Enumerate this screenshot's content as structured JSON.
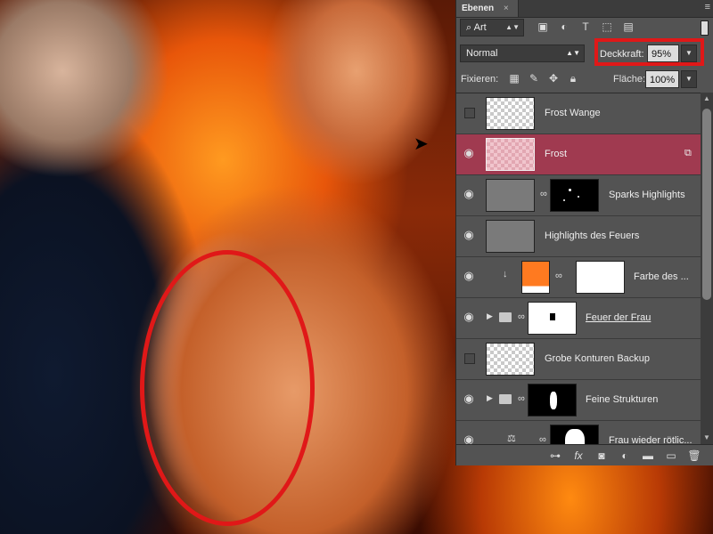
{
  "panel": {
    "tab_label": "Ebenen",
    "tab_close": "×",
    "menu_icon": "panel-menu-icon",
    "filter": {
      "selected": "Art",
      "icons": [
        "image-filter-icon",
        "adjustment-filter-icon",
        "type-filter-icon",
        "shape-filter-icon",
        "smart-object-filter-icon"
      ]
    },
    "blend_mode": "Normal",
    "opacity": {
      "label": "Deckkraft:",
      "value": "95%"
    },
    "lock": {
      "label": "Fixieren:",
      "icons": [
        "lock-transparency-icon",
        "lock-image-icon",
        "lock-position-icon",
        "lock-all-icon"
      ]
    },
    "fill": {
      "label": "Fläche:",
      "value": "100%"
    },
    "layers": [
      {
        "name": "Frost Wange",
        "visible": false,
        "selected": false,
        "thumb": "checker"
      },
      {
        "name": "Frost",
        "visible": true,
        "selected": true,
        "thumb": "tint",
        "smart": true
      },
      {
        "name": "Sparks Highlights",
        "visible": true,
        "selected": false,
        "thumb": "grey",
        "mask": "black"
      },
      {
        "name": "Highlights des Feuers",
        "visible": true,
        "selected": false,
        "thumb": "grey"
      },
      {
        "name": "Farbe des ...",
        "visible": true,
        "selected": false,
        "thumb": "orange",
        "mask": "white",
        "clipped": true
      },
      {
        "name": "Feuer der Frau",
        "visible": true,
        "selected": false,
        "group": true,
        "mask": "white"
      },
      {
        "name": "Grobe Konturen Backup",
        "visible": false,
        "selected": false,
        "thumb": "checker"
      },
      {
        "name": "Feine Strukturen",
        "visible": true,
        "selected": false,
        "group": true,
        "mask": "black"
      },
      {
        "name": "Frau wieder rötlic...",
        "visible": true,
        "selected": false,
        "adjustment": true,
        "mask": "black"
      }
    ],
    "footer_icons": [
      "link-layers-icon",
      "fx-icon",
      "add-mask-icon",
      "new-adjustment-icon",
      "new-group-icon",
      "new-layer-icon",
      "delete-layer-icon"
    ]
  },
  "colors": {
    "panel_bg": "#535353",
    "selected_layer": "#a03a50",
    "annotation_red": "#e01818"
  }
}
